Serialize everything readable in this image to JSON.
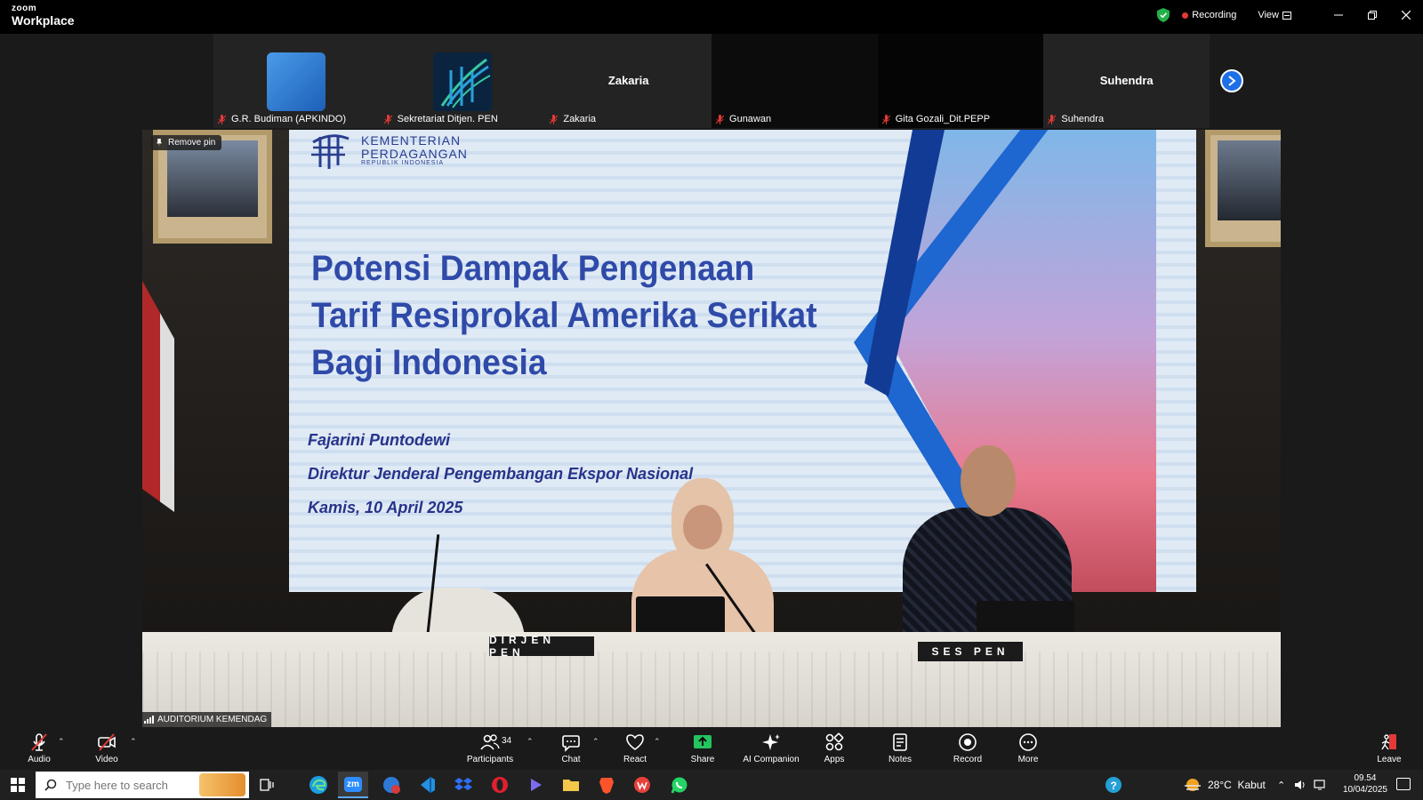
{
  "window": {
    "brand_line1": "zoom",
    "brand_line2": "Workplace",
    "recording_label": "Recording",
    "view_label": "View"
  },
  "participants": [
    {
      "name": "G.R. Budiman (APKINDO)",
      "avatar": "blue-square"
    },
    {
      "name": "Sekretariat Ditjen. PEN",
      "avatar": "logo"
    },
    {
      "name": "Zakaria",
      "display": "Zakaria"
    },
    {
      "name": "Gunawan"
    },
    {
      "name": "Gita Gozali_Dit.PEPP"
    },
    {
      "name": "Suhendra",
      "display": "Suhendra"
    }
  ],
  "main_video": {
    "remove_pin_label": "Remove pin",
    "source_label": "AUDITORIUM KEMENDAG",
    "slide": {
      "org_line1": "KEMENTERIAN",
      "org_line2": "PERDAGANGAN",
      "org_line3": "REPUBLIK INDONESIA",
      "title_lines": [
        "Potensi Dampak Pengenaan",
        "Tarif Resiprokal Amerika Serikat",
        "Bagi Indonesia"
      ],
      "presenter_name": "Fajarini Puntodewi",
      "presenter_role": "Direktur Jenderal Pengembangan Ekspor Nasional",
      "date": "Kamis, 10 April 2025"
    },
    "nameplates": [
      "DIRJEN PEN",
      "SES PEN"
    ]
  },
  "toolbar": {
    "audio": "Audio",
    "video": "Video",
    "participants": "Participants",
    "participants_count": "34",
    "chat": "Chat",
    "react": "React",
    "share": "Share",
    "ai_companion": "AI Companion",
    "apps": "Apps",
    "notes": "Notes",
    "record": "Record",
    "more": "More",
    "leave": "Leave"
  },
  "taskbar": {
    "search_placeholder": "Type here to search",
    "zoom_app_label": "zm",
    "weather": "28°C  Kabut",
    "time": "09.54",
    "date": "10/04/2025"
  },
  "colors": {
    "share_green": "#22c55e",
    "accent_blue": "#1e6fe8",
    "mic_off_red": "#e53935"
  }
}
